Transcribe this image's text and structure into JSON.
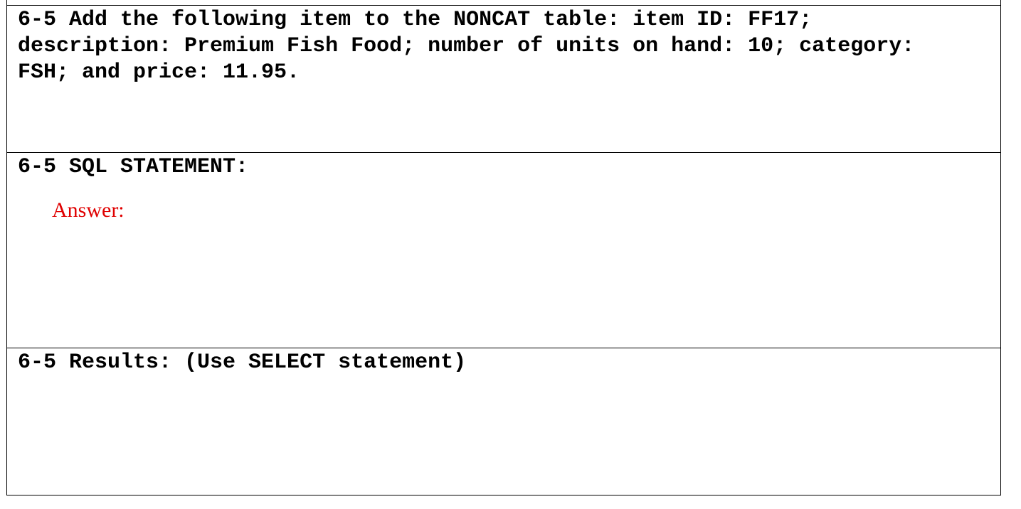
{
  "exercise": {
    "prompt": "6-5 Add the following item to the NONCAT table: item ID: FF17; description: Premium Fish Food; number of units on hand: 10; category: FSH; and price: 11.95.",
    "prompt_lines": [
      "6-5 Add the following item to the NONCAT table: item ID: FF17;",
      "description: Premium Fish Food; number of units on hand: 10; category:",
      "FSH; and price: 11.95."
    ],
    "sql_heading": "6-5 SQL STATEMENT:",
    "answer_label": "Answer:",
    "results_heading": "6-5 Results: (Use SELECT statement)",
    "answer_color": "#e00000"
  }
}
